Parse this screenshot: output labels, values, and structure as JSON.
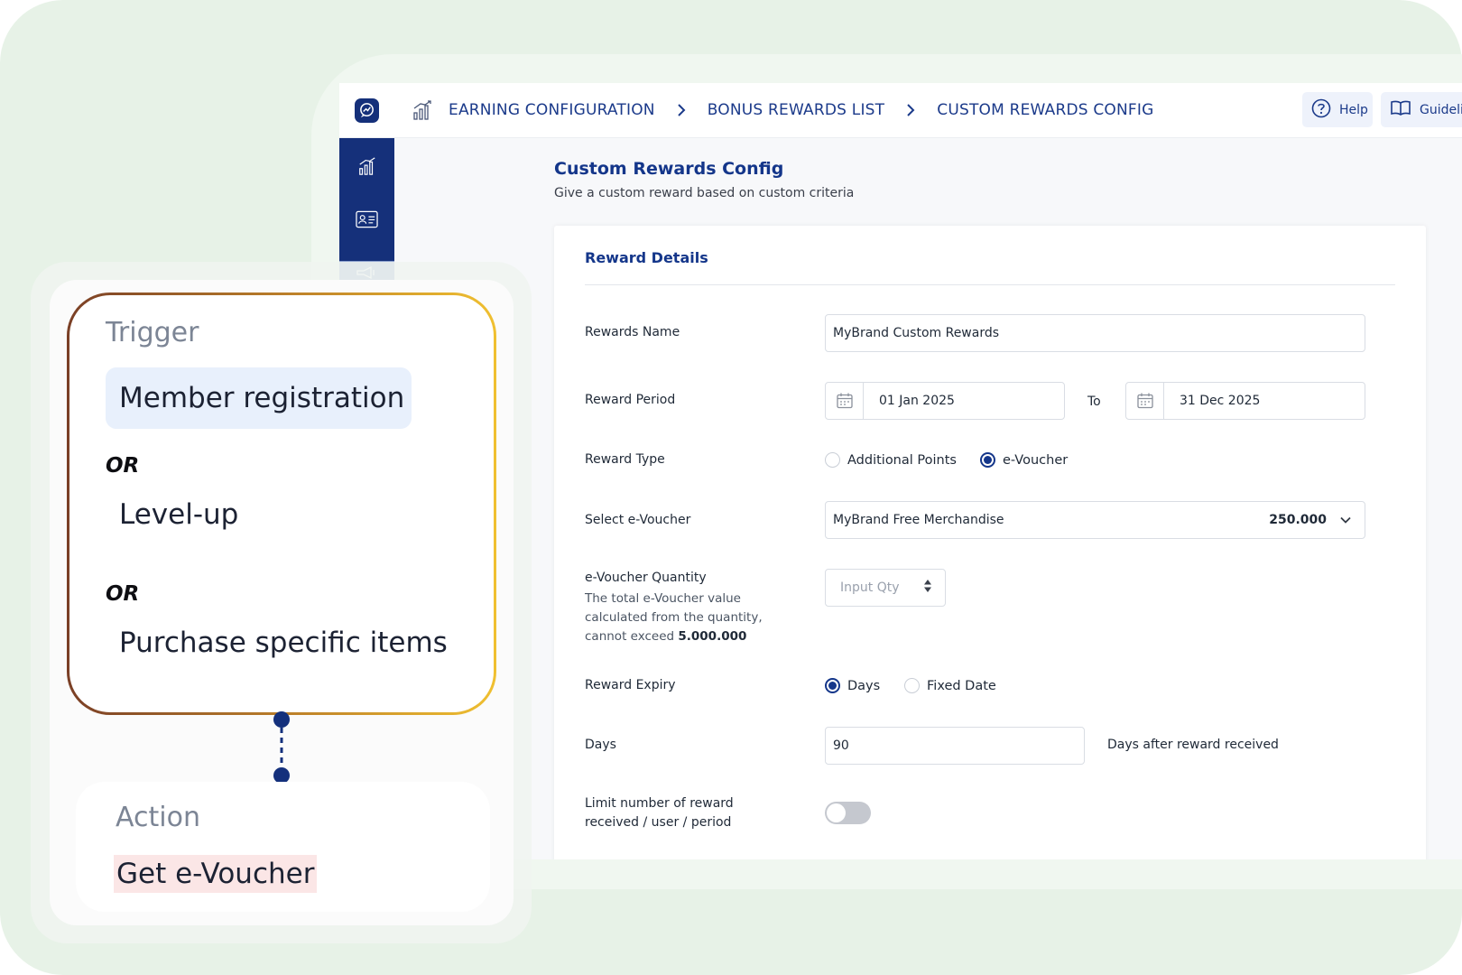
{
  "breadcrumb": {
    "items": [
      "EARNING CONFIGURATION",
      "BONUS REWARDS LIST",
      "CUSTOM REWARDS CONFIG"
    ]
  },
  "topbar": {
    "help_label": "Help",
    "guidelines_label": "Guidelin"
  },
  "page": {
    "title": "Custom Rewards Config",
    "subtitle": "Give a custom reward based on custom criteria"
  },
  "form": {
    "section_title": "Reward Details",
    "rewards_name": {
      "label": "Rewards Name",
      "value": "MyBrand Custom Rewards"
    },
    "reward_period": {
      "label": "Reward Period",
      "start": "01 Jan 2025",
      "to_label": "To",
      "end": "31 Dec 2025"
    },
    "reward_type": {
      "label": "Reward Type",
      "options": [
        "Additional Points",
        "e-Voucher"
      ],
      "selected": "e-Voucher"
    },
    "select_voucher": {
      "label": "Select e-Voucher",
      "value": "MyBrand Free Merchandise",
      "amount": "250.000"
    },
    "voucher_quantity": {
      "label": "e-Voucher Quantity",
      "note": "The total e-Voucher value calculated from the quantity, cannot exceed",
      "limit": "5.000.000",
      "placeholder": "Input Qty"
    },
    "reward_expiry": {
      "label": "Reward Expiry",
      "options": [
        "Days",
        "Fixed Date"
      ],
      "selected": "Days"
    },
    "days": {
      "label": "Days",
      "value": "90",
      "suffix": "Days after reward received"
    },
    "limit_toggle": {
      "label_line1": "Limit number of reward",
      "label_line2": "received / user / period",
      "enabled": false
    }
  },
  "flow": {
    "trigger_title": "Trigger",
    "trigger_options": [
      "Member registration",
      "Level-up",
      "Purchase specific items"
    ],
    "or_label": "OR",
    "action_title": "Action",
    "action_value": "Get e-Voucher"
  },
  "colors": {
    "brand": "#15307a",
    "accent_text": "#14368a",
    "bg_green": "#e7f2e7",
    "trigger_chip": "#e8f0fc",
    "action_chip": "#fbe6e6"
  },
  "icons": {
    "logo": "analytics-chat-icon",
    "breadcrumb": "bar-chart-icon",
    "help": "question-circle-icon",
    "guidelines": "book-icon",
    "date": "calendar-icon",
    "select": "chevron-down-icon",
    "stepper": "up-down-arrows-icon"
  }
}
